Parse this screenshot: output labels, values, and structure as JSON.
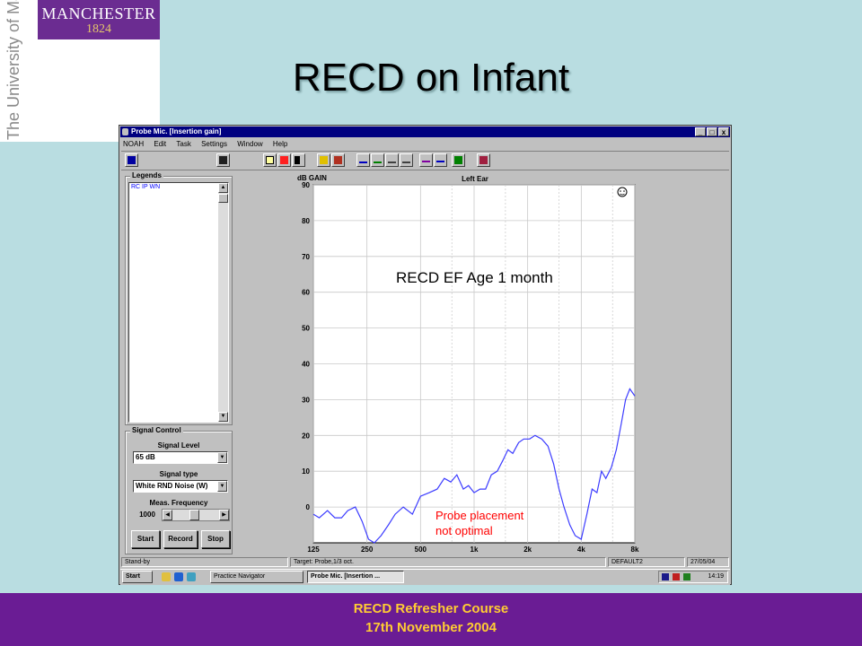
{
  "slide": {
    "title": "RECD on Infant",
    "footer_line1": "RECD Refresher Course",
    "footer_line2": "17th November 2004"
  },
  "logo": {
    "name": "MANCHESTER",
    "year": "1824",
    "vertical": "The University of Manchester"
  },
  "window": {
    "title": "Probe Mic. [Insertion gain]",
    "controls": [
      "_",
      "□",
      "x"
    ],
    "menu": [
      "NOAH",
      "Edit",
      "Task",
      "Settings",
      "Window",
      "Help"
    ]
  },
  "toolbar_icons": [
    "hearing-aid-icon",
    "save-icon",
    "cursor-icon",
    "recd-icon",
    "calibrate-icon",
    "info-icon",
    "wrench-icon",
    "curve1-icon",
    "curve2-icon",
    "curve3-icon",
    "curve4-icon",
    "curve5-icon",
    "curve6-icon",
    "green-book-icon",
    "red-book-icon"
  ],
  "legends": {
    "label": "Legends",
    "items": [
      "RC IP WN"
    ]
  },
  "signal_control": {
    "label": "Signal Control",
    "level_label": "Signal Level",
    "level_value": "65 dB",
    "type_label": "Signal type",
    "type_value": "White RND Noise (W)",
    "freq_label": "Meas. Frequency",
    "freq_value": "1000",
    "buttons": [
      "Start",
      "Record",
      "Stop"
    ]
  },
  "status": {
    "left": "Stand-by",
    "mid": "Target: Probe,1/3 oct.",
    "right1": "DEFAULT2",
    "right2": "27/05/04"
  },
  "taskbar": {
    "start": "Start",
    "tasks": [
      "Practice Navigator",
      "Probe Mic. [Insertion ..."
    ],
    "clock": "14:19"
  },
  "chart_data": {
    "type": "line",
    "title": "Left Ear",
    "ylabel": "dB GAIN",
    "xscale": "log",
    "ylim": [
      -10,
      90
    ],
    "yticks": [
      90,
      80,
      70,
      60,
      50,
      40,
      30,
      20,
      10,
      0
    ],
    "xticks": [
      125,
      250,
      500,
      1000,
      2000,
      4000,
      8000
    ],
    "xticklabels": [
      "125",
      "250",
      "500",
      "1k",
      "2k",
      "4k",
      "8k"
    ],
    "grid": true,
    "annotations": [
      "RECD EF Age 1 month",
      "Probe placement",
      "not optimal"
    ],
    "line_color": "#3c3cff",
    "series": [
      {
        "x": [
          125,
          135,
          150,
          165,
          180,
          195,
          215,
          235,
          255,
          275,
          300,
          330,
          360,
          400,
          450,
          500,
          560,
          620,
          680,
          740,
          800,
          870,
          930,
          1000,
          1080,
          1160,
          1250,
          1350,
          1450,
          1550,
          1650,
          1780,
          1900,
          2050,
          2200,
          2400,
          2600,
          2800,
          3000,
          3200,
          3450,
          3700,
          4000,
          4300,
          4600,
          4900,
          5200,
          5500,
          5900,
          6300,
          6700,
          7100,
          7500,
          8000
        ],
        "y": [
          -2,
          -3,
          -1,
          -3,
          -3,
          -1,
          0,
          -4,
          -9,
          -10,
          -8,
          -5,
          -2,
          0,
          -2,
          3,
          4,
          5,
          8,
          7,
          9,
          5,
          6,
          4,
          5,
          5,
          9,
          10,
          13,
          16,
          15,
          18,
          19,
          19,
          20,
          19,
          17,
          12,
          5,
          0,
          -5,
          -8,
          -9,
          -2,
          5,
          4,
          10,
          8,
          11,
          16,
          23,
          30,
          33,
          31
        ]
      }
    ]
  }
}
